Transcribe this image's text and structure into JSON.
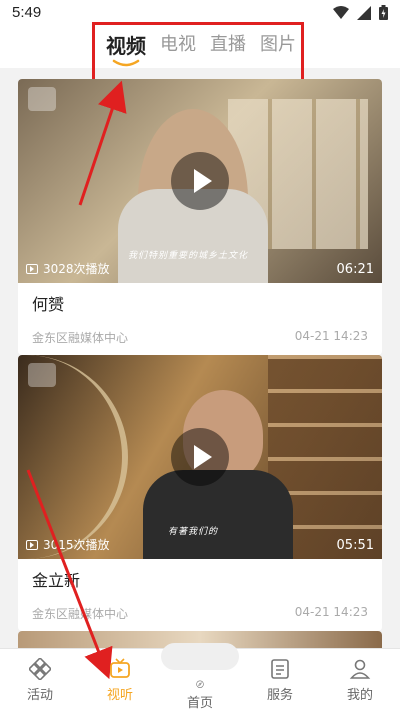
{
  "status": {
    "time": "5:49"
  },
  "tabs": [
    {
      "label": "视频"
    },
    {
      "label": "电视"
    },
    {
      "label": "直播"
    },
    {
      "label": "图片"
    }
  ],
  "videos": [
    {
      "views": "3028次播放",
      "duration": "06:21",
      "title": "何赟",
      "source": "金东区融媒体中心",
      "date": "04-21 14:23",
      "caption": "我们特别重要的城乡土文化"
    },
    {
      "views": "3015次播放",
      "duration": "05:51",
      "title": "金立新",
      "source": "金东区融媒体中心",
      "date": "04-21 14:23",
      "caption": "有著我们的"
    }
  ],
  "bottom_nav": [
    {
      "label": "活动",
      "icon": "activity-icon"
    },
    {
      "label": "视听",
      "icon": "tv-icon"
    },
    {
      "label": "首页",
      "icon": "compass-icon"
    },
    {
      "label": "服务",
      "icon": "document-icon"
    },
    {
      "label": "我的",
      "icon": "person-icon"
    }
  ],
  "colors": {
    "accent": "#f5a623",
    "annotation": "#e02020"
  }
}
